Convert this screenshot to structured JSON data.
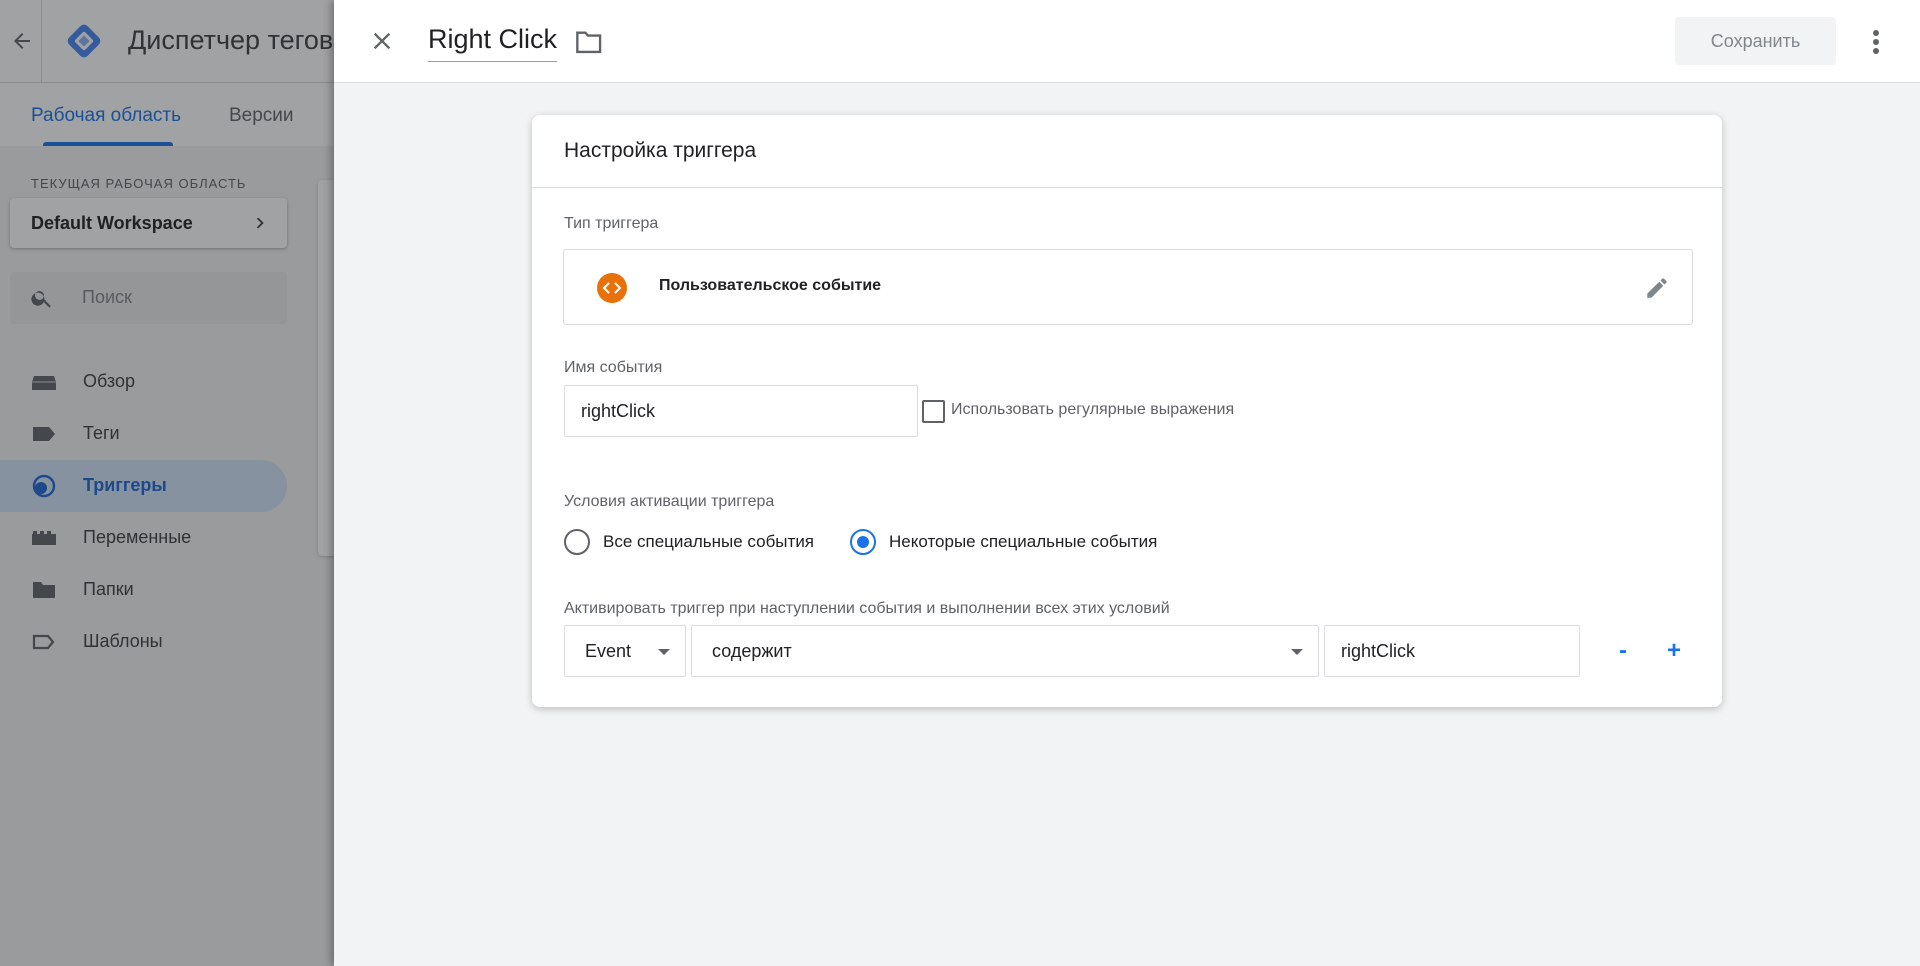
{
  "app": {
    "title": "Диспетчер тегов",
    "tabs": [
      {
        "label": "Рабочая область",
        "active": true
      },
      {
        "label": "Версии",
        "active": false
      }
    ],
    "workspace_section_label": "ТЕКУЩАЯ РАБОЧАЯ ОБЛАСТЬ",
    "workspace_name": "Default Workspace",
    "search_placeholder": "Поиск",
    "nav": [
      {
        "label": "Обзор",
        "icon": "overview-icon"
      },
      {
        "label": "Теги",
        "icon": "tag-icon"
      },
      {
        "label": "Триггеры",
        "icon": "trigger-icon",
        "active": true
      },
      {
        "label": "Переменные",
        "icon": "variables-icon"
      },
      {
        "label": "Папки",
        "icon": "folder-icon"
      },
      {
        "label": "Шаблоны",
        "icon": "template-icon"
      }
    ]
  },
  "editor": {
    "trigger_name": "Right Click",
    "save_label": "Сохранить",
    "card_title": "Настройка триггера",
    "trigger_type_label": "Тип триггера",
    "trigger_type_name": "Пользовательское событие",
    "event_name_label": "Имя события",
    "event_name_value": "rightClick",
    "regex_label": "Использовать регулярные выражения",
    "regex_checked": false,
    "conditions_label": "Условия активации триггера",
    "radio_all_label": "Все специальные события",
    "radio_some_label": "Некоторые специальные события",
    "selected_condition": "some",
    "filter_label": "Активировать триггер при наступлении события и выполнении всех этих условий",
    "filter": {
      "variable": "Event",
      "operator": "содержит",
      "value": "rightClick"
    },
    "remove_label": "-",
    "add_label": "+"
  },
  "colors": {
    "accent": "#1a73e8",
    "trigger_type_icon": "#e8710a",
    "logo_blue": "#4285f4"
  }
}
